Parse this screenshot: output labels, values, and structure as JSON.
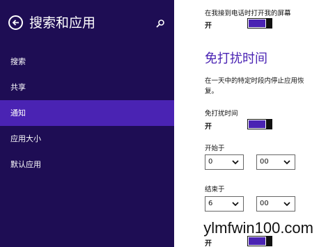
{
  "colors": {
    "nav_background": "#1e0d54",
    "selected_item": "#4a23b3",
    "accent": "#4a23b3"
  },
  "nav": {
    "back_icon": "back-arrow-icon",
    "title": "搜索和应用",
    "search_icon": "search-icon",
    "items": [
      {
        "label": "搜索",
        "selected": false
      },
      {
        "label": "共享",
        "selected": false
      },
      {
        "label": "通知",
        "selected": true
      },
      {
        "label": "应用大小",
        "selected": false
      },
      {
        "label": "默认应用",
        "selected": false
      }
    ]
  },
  "content": {
    "lockscreen_setting": {
      "label": "在我接到电话时打开我的屏幕",
      "state": "开",
      "on": true
    },
    "quiet_hours": {
      "heading": "免打扰时间",
      "description": "在一天中的特定时段内停止应用恢复。",
      "toggle_label": "免打扰时间",
      "state": "开",
      "on": true,
      "start": {
        "label": "开始于",
        "hour": "0",
        "minute": "00"
      },
      "end": {
        "label": "结束于",
        "hour": "6",
        "minute": "00"
      },
      "calls_state": "开"
    }
  },
  "watermark": "ylmfwin100.com"
}
